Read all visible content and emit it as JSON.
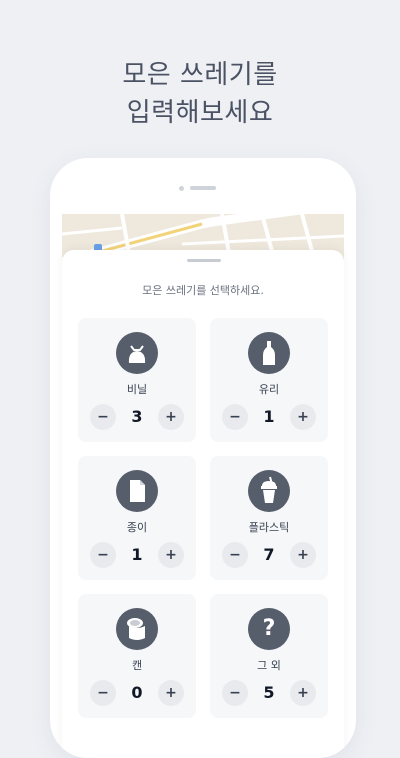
{
  "headline": {
    "line1": "모은 쓰레기를",
    "line2": "입력해보세요"
  },
  "sheet": {
    "instruction": "모은 쓰레기를 선택하세요."
  },
  "items": [
    {
      "label": "비닐",
      "count": "3",
      "icon": "plastic-bag-icon",
      "minus": "−",
      "plus": "+"
    },
    {
      "label": "유리",
      "count": "1",
      "icon": "glass-bottle-icon",
      "minus": "−",
      "plus": "+"
    },
    {
      "label": "종이",
      "count": "1",
      "icon": "paper-document-icon",
      "minus": "−",
      "plus": "+"
    },
    {
      "label": "플라스틱",
      "count": "7",
      "icon": "plastic-cup-icon",
      "minus": "−",
      "plus": "+"
    },
    {
      "label": "캔",
      "count": "0",
      "icon": "can-icon",
      "minus": "−",
      "plus": "+"
    },
    {
      "label": "그 외",
      "count": "5",
      "icon": "question-icon",
      "minus": "−",
      "plus": "+",
      "icon_glyph": "?"
    }
  ],
  "colors": {
    "background": "#eef0f4",
    "icon_circle": "#565d6b",
    "card": "#f6f7f9",
    "button": "#e8eaee"
  }
}
